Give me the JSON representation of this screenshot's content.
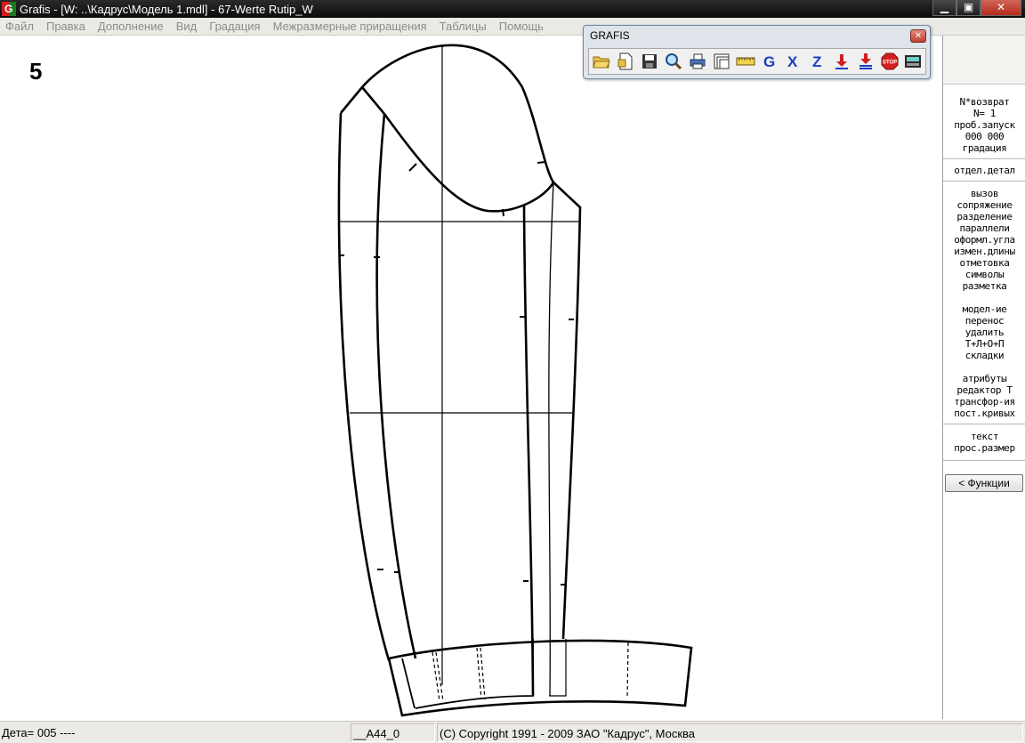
{
  "window": {
    "app_icon_letter": "G",
    "title": "Grafis - [W: ..\\Кадрус\\Модель 1.mdl] - 67-Werte Rutip_W",
    "minimize": "▁",
    "maximize": "▣",
    "close": "✕"
  },
  "menu": [
    "Файл",
    "Правка",
    "Дополнение",
    "Вид",
    "Градация",
    "Межразмерные приращения",
    "Таблицы",
    "Помощь"
  ],
  "canvas": {
    "piece_number": "5"
  },
  "toolbar_window": {
    "title": "GRAFIS",
    "close": "✕",
    "buttons": [
      {
        "icon": "open-folder-icon"
      },
      {
        "icon": "open-file-icon"
      },
      {
        "icon": "save-disk-icon"
      },
      {
        "icon": "magnifier-icon"
      },
      {
        "icon": "printer-icon"
      },
      {
        "icon": "cascade-windows-icon"
      },
      {
        "icon": "ruler-icon"
      },
      {
        "icon": "letter-g-icon",
        "text": "G"
      },
      {
        "icon": "letter-x-icon",
        "text": "X"
      },
      {
        "icon": "letter-z-icon",
        "text": "Z"
      },
      {
        "icon": "arrow-down-icon"
      },
      {
        "icon": "arrow-down-double-icon"
      },
      {
        "icon": "stop-icon",
        "text": "STOP"
      },
      {
        "icon": "calculator-icon"
      }
    ]
  },
  "side_panel": {
    "status": [
      "N*возврат",
      "N=  1",
      "проб.запуск",
      "000 000",
      "градация"
    ],
    "group1": [
      "отдел.детал"
    ],
    "group2": [
      "вызов",
      "сопряжение",
      "разделение",
      "параллели",
      "оформл.угла",
      "измен.длины",
      "отметовка",
      "символы",
      "разметка"
    ],
    "group3": [
      "модел-ие",
      "перенос",
      "удалить",
      "Т+Л+О+П",
      "складки"
    ],
    "group4": [
      "атрибуты",
      "редактор Т",
      "трансфор-ия",
      "пост.кривых"
    ],
    "group5": [
      "текст",
      "прос.размер"
    ],
    "functions_button": "< Функции"
  },
  "status_bar": {
    "left": "Дета= 005  ----",
    "middle": "__A44_0",
    "right": "(C) Copyright 1991 - 2009 ЗАО \"Кадрус\", Москва"
  }
}
